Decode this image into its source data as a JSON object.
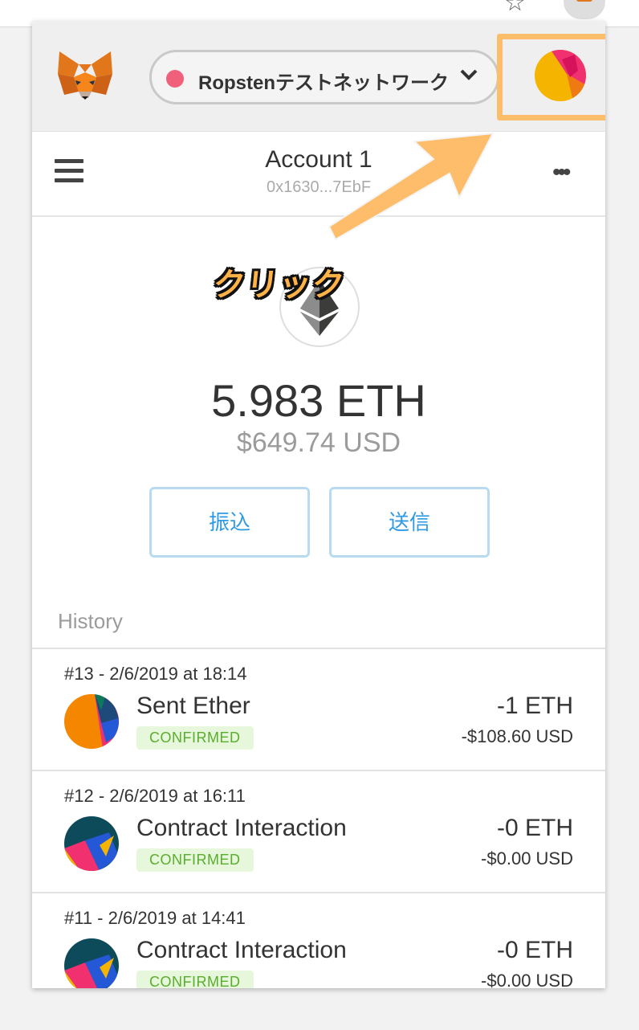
{
  "network": {
    "label": "Ropstenテストネットワーク",
    "dot_color": "#f0607a"
  },
  "account": {
    "name": "Account 1",
    "address": "0x1630...7EbF"
  },
  "annotation": {
    "label": "クリック",
    "highlight_color": "#fdbd6b"
  },
  "balance": {
    "eth": "5.983 ETH",
    "usd": "$649.74 USD"
  },
  "actions": {
    "deposit": "振込",
    "send": "送信"
  },
  "history": {
    "label": "History",
    "items": [
      {
        "date": "#13 - 2/6/2019 at 18:14",
        "title": "Sent Ether",
        "status": "CONFIRMED",
        "amount": "-1 ETH",
        "fiat": "-$108.60 USD"
      },
      {
        "date": "#12 - 2/6/2019 at 16:11",
        "title": "Contract Interaction",
        "status": "CONFIRMED",
        "amount": "-0 ETH",
        "fiat": "-$0.00 USD"
      },
      {
        "date": "#11 - 2/6/2019 at 14:41",
        "title": "Contract Interaction",
        "status": "CONFIRMED",
        "amount": "-0 ETH",
        "fiat": "-$0.00 USD"
      }
    ]
  },
  "icons": {
    "logo": "metamask-fox-icon",
    "menu": "hamburger-menu-icon",
    "more": "more-options-icon",
    "chevron": "chevron-down-icon",
    "account": "account-identicon",
    "currency": "ethereum-icon"
  }
}
